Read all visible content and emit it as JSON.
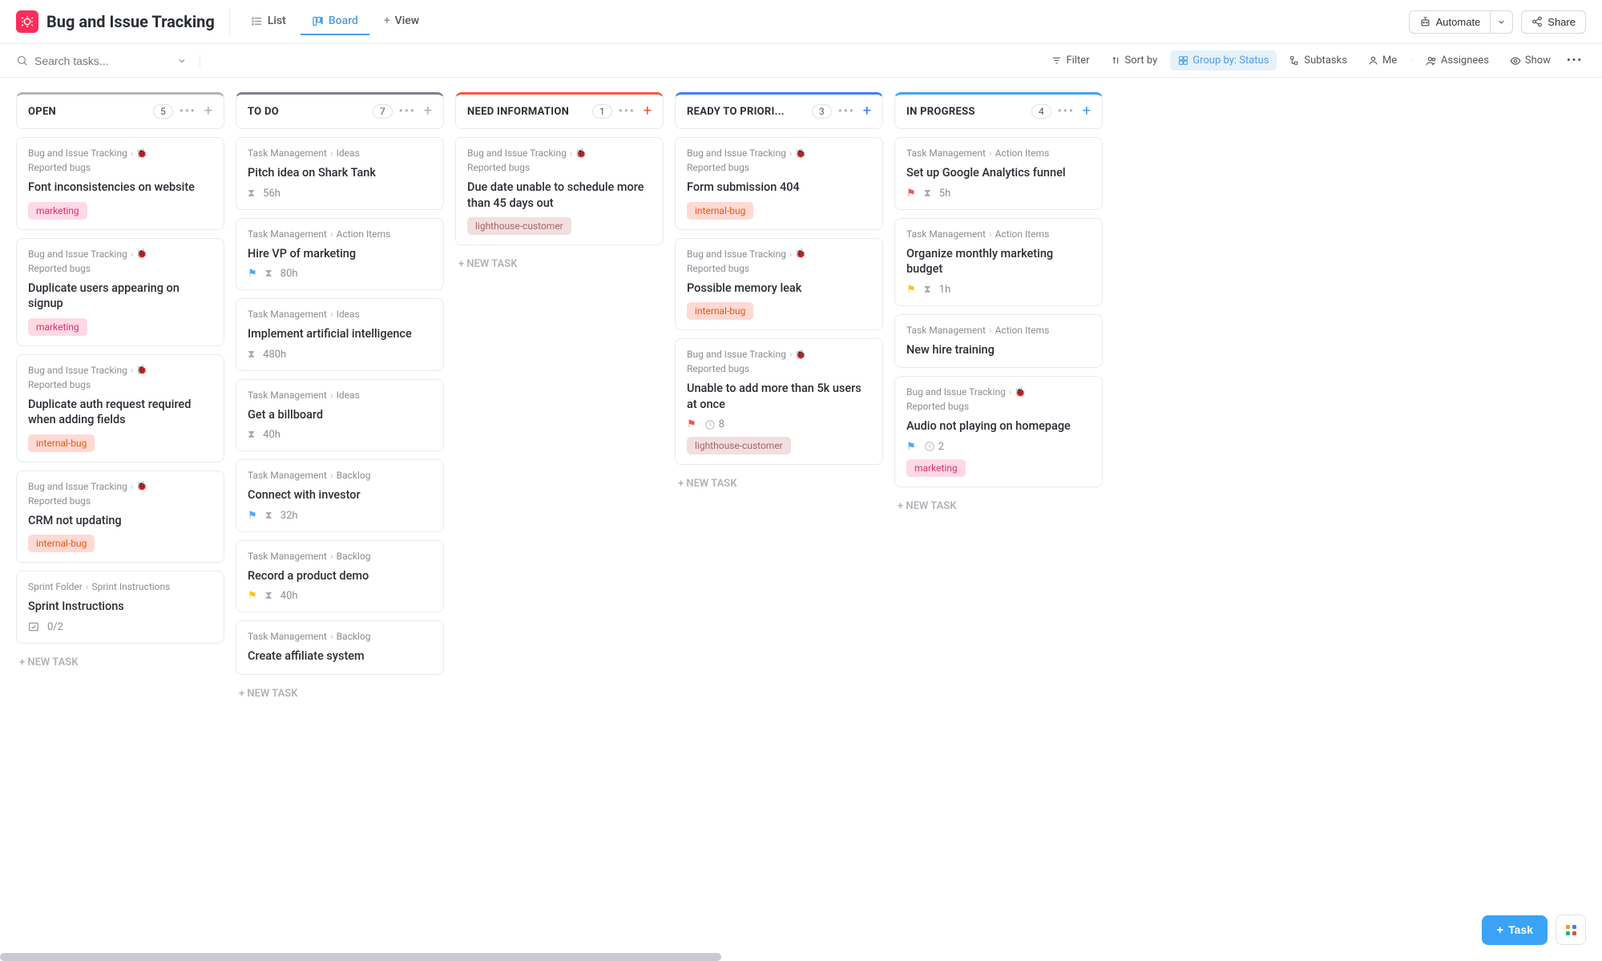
{
  "header": {
    "title": "Bug and Issue Tracking",
    "tabs": {
      "list": "List",
      "board": "Board",
      "view": "View"
    },
    "automate": "Automate",
    "share": "Share"
  },
  "toolbar": {
    "searchPlaceholder": "Search tasks...",
    "filter": "Filter",
    "sort": "Sort by",
    "groupBy": "Group by: Status",
    "subtasks": "Subtasks",
    "me": "Me",
    "assignees": "Assignees",
    "show": "Show"
  },
  "newTask": "+ NEW TASK",
  "fab": {
    "task": "Task"
  },
  "columns": [
    {
      "id": "open",
      "title": "OPEN",
      "count": "5",
      "color": "#b0b3b8",
      "plusColor": "#b0b3b8",
      "cards": [
        {
          "crumb1": "Bug and Issue Tracking",
          "crumb2": "Reported bugs",
          "bug": true,
          "title": "Font inconsistencies on website",
          "tags": [
            {
              "text": "marketing",
              "cls": "marketing"
            }
          ]
        },
        {
          "crumb1": "Bug and Issue Tracking",
          "crumb2": "Reported bugs",
          "bug": true,
          "title": "Duplicate users appearing on signup",
          "tags": [
            {
              "text": "marketing",
              "cls": "marketing"
            }
          ]
        },
        {
          "crumb1": "Bug and Issue Tracking",
          "crumb2": "Reported bugs",
          "bug": true,
          "title": "Duplicate auth request required when adding fields",
          "tags": [
            {
              "text": "internal-bug",
              "cls": "internal"
            }
          ]
        },
        {
          "crumb1": "Bug and Issue Tracking",
          "crumb2": "Reported bugs",
          "bug": true,
          "title": "CRM not updating",
          "tags": [
            {
              "text": "internal-bug",
              "cls": "internal"
            }
          ]
        },
        {
          "crumb1": "Sprint Folder",
          "crumb2": "Sprint Instructions",
          "bug": false,
          "title": "Sprint Instructions",
          "checklist": "0/2"
        }
      ]
    },
    {
      "id": "todo",
      "title": "TO DO",
      "count": "7",
      "color": "#7c828d",
      "plusColor": "#b0b3b8",
      "cards": [
        {
          "crumb1": "Task Management",
          "crumb2": "Ideas",
          "title": "Pitch idea on Shark Tank",
          "time": "56h"
        },
        {
          "crumb1": "Task Management",
          "crumb2": "Action Items",
          "title": "Hire VP of marketing",
          "flag": "blue",
          "time": "80h"
        },
        {
          "crumb1": "Task Management",
          "crumb2": "Ideas",
          "title": "Implement artificial intelligence",
          "time": "480h"
        },
        {
          "crumb1": "Task Management",
          "crumb2": "Ideas",
          "title": "Get a billboard",
          "time": "40h"
        },
        {
          "crumb1": "Task Management",
          "crumb2": "Backlog",
          "title": "Connect with investor",
          "flag": "blue",
          "time": "32h"
        },
        {
          "crumb1": "Task Management",
          "crumb2": "Backlog",
          "title": "Record a product demo",
          "flag": "yellow",
          "time": "40h"
        },
        {
          "crumb1": "Task Management",
          "crumb2": "Backlog",
          "title": "Create affiliate system"
        }
      ]
    },
    {
      "id": "needinfo",
      "title": "NEED INFORMATION",
      "count": "1",
      "color": "#fd5a2d",
      "plusColor": "#fd5a2d",
      "cards": [
        {
          "crumb1": "Bug and Issue Tracking",
          "crumb2": "Reported bugs",
          "bug": true,
          "title": "Due date unable to schedule more than 45 days out",
          "tags": [
            {
              "text": "lighthouse-customer",
              "cls": "lighthouse"
            }
          ]
        }
      ]
    },
    {
      "id": "ready",
      "title": "READY TO PRIORI...",
      "count": "3",
      "color": "#3b82f6",
      "plusColor": "#3b82f6",
      "cards": [
        {
          "crumb1": "Bug and Issue Tracking",
          "crumb2": "Reported bugs",
          "bug": true,
          "title": "Form submission 404",
          "tags": [
            {
              "text": "internal-bug",
              "cls": "internal"
            }
          ]
        },
        {
          "crumb1": "Bug and Issue Tracking",
          "crumb2": "Reported bugs",
          "bug": true,
          "title": "Possible memory leak",
          "tags": [
            {
              "text": "internal-bug",
              "cls": "internal"
            }
          ]
        },
        {
          "crumb1": "Bug and Issue Tracking",
          "crumb2": "Reported bugs",
          "bug": true,
          "title": "Unable to add more than 5k users at once",
          "flag": "red",
          "sprint": "8",
          "tags": [
            {
              "text": "lighthouse-customer",
              "cls": "lighthouse"
            }
          ]
        }
      ]
    },
    {
      "id": "progress",
      "title": "IN PROGRESS",
      "count": "4",
      "color": "#3ba3f7",
      "plusColor": "#3ba3f7",
      "cards": [
        {
          "crumb1": "Task Management",
          "crumb2": "Action Items",
          "title": "Set up Google Analytics funnel",
          "flag": "red",
          "time": "5h"
        },
        {
          "crumb1": "Task Management",
          "crumb2": "Action Items",
          "title": "Organize monthly marketing budget",
          "flag": "yellow",
          "time": "1h"
        },
        {
          "crumb1": "Task Management",
          "crumb2": "Action Items",
          "title": "New hire training"
        },
        {
          "crumb1": "Bug and Issue Tracking",
          "crumb2": "Reported bugs",
          "bug": true,
          "title": "Audio not playing on homepage",
          "flag": "blue",
          "sprint": "2",
          "tags": [
            {
              "text": "marketing",
              "cls": "marketing"
            }
          ]
        }
      ]
    }
  ]
}
